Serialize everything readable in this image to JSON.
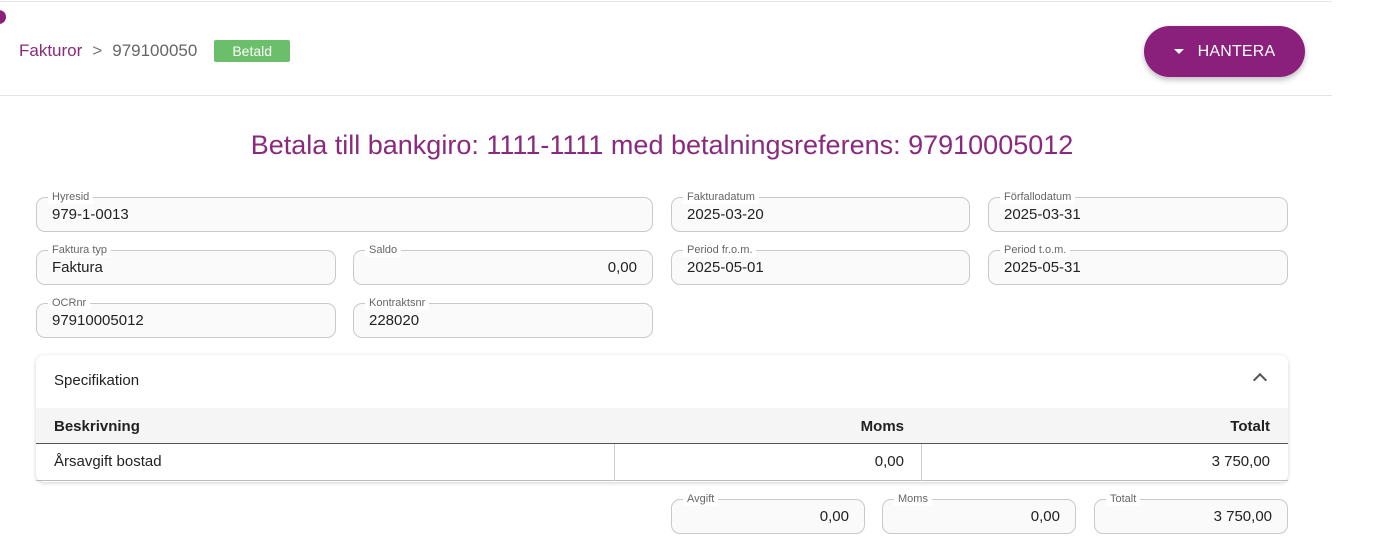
{
  "header": {
    "breadcrumb_root": "Fakturor",
    "breadcrumb_separator": ">",
    "breadcrumb_current": "979100050",
    "status_badge": "Betald",
    "status_color": "#6cbf6a",
    "manage_button": "HANTERA",
    "accent_color": "#8a1f7c"
  },
  "payment_title": "Betala till bankgiro: 1111-1111 med betalningsreferens: 97910005012",
  "fields": {
    "hyresid": {
      "label": "Hyresid",
      "value": "979-1-0013"
    },
    "fakturadatum": {
      "label": "Fakturadatum",
      "value": "2025-03-20"
    },
    "forfallodatum": {
      "label": "Förfallodatum",
      "value": "2025-03-31"
    },
    "faktura_typ": {
      "label": "Faktura typ",
      "value": "Faktura"
    },
    "saldo": {
      "label": "Saldo",
      "value": "0,00"
    },
    "period_from": {
      "label": "Period fr.o.m.",
      "value": "2025-05-01"
    },
    "period_tom": {
      "label": "Period t.o.m.",
      "value": "2025-05-31"
    },
    "ocrnr": {
      "label": "OCRnr",
      "value": "97910005012"
    },
    "kontraktsnr": {
      "label": "Kontraktsnr",
      "value": "228020"
    }
  },
  "specification": {
    "title": "Specifikation",
    "columns": {
      "beskrivning": "Beskrivning",
      "moms": "Moms",
      "totalt": "Totalt"
    },
    "rows": [
      {
        "beskrivning": "Årsavgift bostad",
        "moms": "0,00",
        "totalt": "3 750,00"
      }
    ]
  },
  "totals": {
    "avgift": {
      "label": "Avgift",
      "value": "0,00"
    },
    "moms": {
      "label": "Moms",
      "value": "0,00"
    },
    "totalt": {
      "label": "Totalt",
      "value": "3 750,00"
    }
  }
}
